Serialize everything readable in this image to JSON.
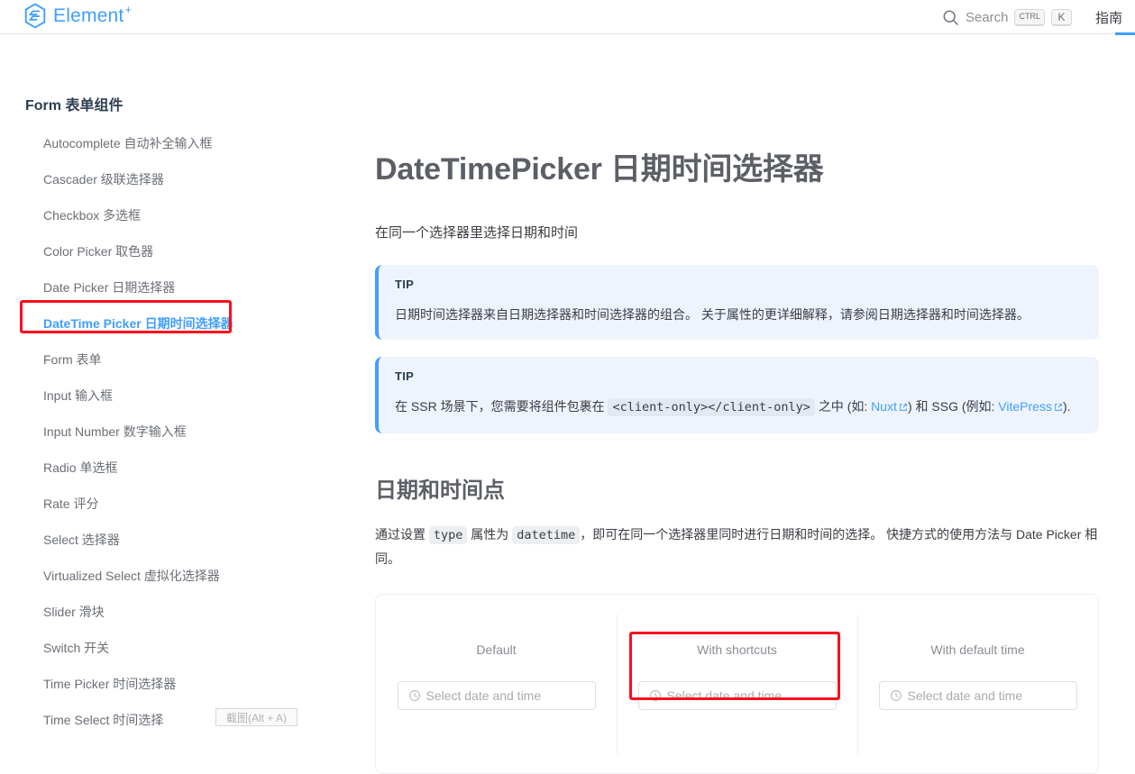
{
  "header": {
    "logo_text": "Element",
    "logo_superscript": "+",
    "logo_icon": "element-hexagon-logo-icon",
    "search": {
      "icon": "search-icon",
      "label": "Search",
      "kbd_ctrl": "CTRL",
      "kbd_key": "K"
    },
    "nav": [
      {
        "label": "指南"
      }
    ]
  },
  "sidebar": {
    "group_title": "Form 表单组件",
    "items": [
      {
        "label": "Autocomplete 自动补全输入框",
        "active": false
      },
      {
        "label": "Cascader 级联选择器",
        "active": false
      },
      {
        "label": "Checkbox 多选框",
        "active": false
      },
      {
        "label": "Color Picker 取色器",
        "active": false
      },
      {
        "label": "Date Picker 日期选择器",
        "active": false
      },
      {
        "label": "DateTime Picker 日期时间选择器",
        "active": true
      },
      {
        "label": "Form 表单",
        "active": false
      },
      {
        "label": "Input 输入框",
        "active": false
      },
      {
        "label": "Input Number 数字输入框",
        "active": false
      },
      {
        "label": "Radio 单选框",
        "active": false
      },
      {
        "label": "Rate 评分",
        "active": false
      },
      {
        "label": "Select 选择器",
        "active": false
      },
      {
        "label": "Virtualized Select 虚拟化选择器",
        "active": false
      },
      {
        "label": "Slider 滑块",
        "active": false
      },
      {
        "label": "Switch 开关",
        "active": false
      },
      {
        "label": "Time Picker 时间选择器",
        "active": false
      },
      {
        "label": "Time Select 时间选择",
        "active": false
      }
    ]
  },
  "main": {
    "page_title": "DateTimePicker 日期时间选择器",
    "page_subtitle": "在同一个选择器里选择日期和时间",
    "tips": [
      {
        "label": "TIP",
        "text": "日期时间选择器来自日期选择器和时间选择器的组合。 关于属性的更详细解释，请参阅日期选择器和时间选择器。"
      },
      {
        "label": "TIP",
        "text_part1": "在 SSR 场景下，您需要将组件包裹在",
        "code": "<client-only></client-only>",
        "text_part2": "之中 (如:",
        "link1": "Nuxt",
        "text_part3": ") 和 SSG (例如:",
        "link2": "VitePress",
        "text_part4": ")."
      }
    ],
    "section": {
      "title": "日期和时间点",
      "para_part1": "通过设置",
      "code1": "type",
      "para_part2": "属性为",
      "code2": "datetime",
      "para_part3": "，即可在同一个选择器里同时进行日期和时间的选择。 快捷方式的使用方法与 Date Picker 相同。"
    },
    "demo": {
      "columns": [
        {
          "title": "Default",
          "icon": "clock-icon",
          "placeholder": "Select date and time",
          "annotated": false
        },
        {
          "title": "With shortcuts",
          "icon": "clock-icon",
          "placeholder": "Select date and time",
          "annotated": true
        },
        {
          "title": "With default time",
          "icon": "clock-icon",
          "placeholder": "Select date and time",
          "annotated": false
        }
      ]
    }
  },
  "overlay": {
    "screenshot_tooltip": "截图(Alt + A)",
    "annotation_color": "#fc0d1c"
  },
  "colors": {
    "brand": "#409eff",
    "tip_bg": "#eef4fd",
    "active_bg": "#ecf5ff"
  }
}
